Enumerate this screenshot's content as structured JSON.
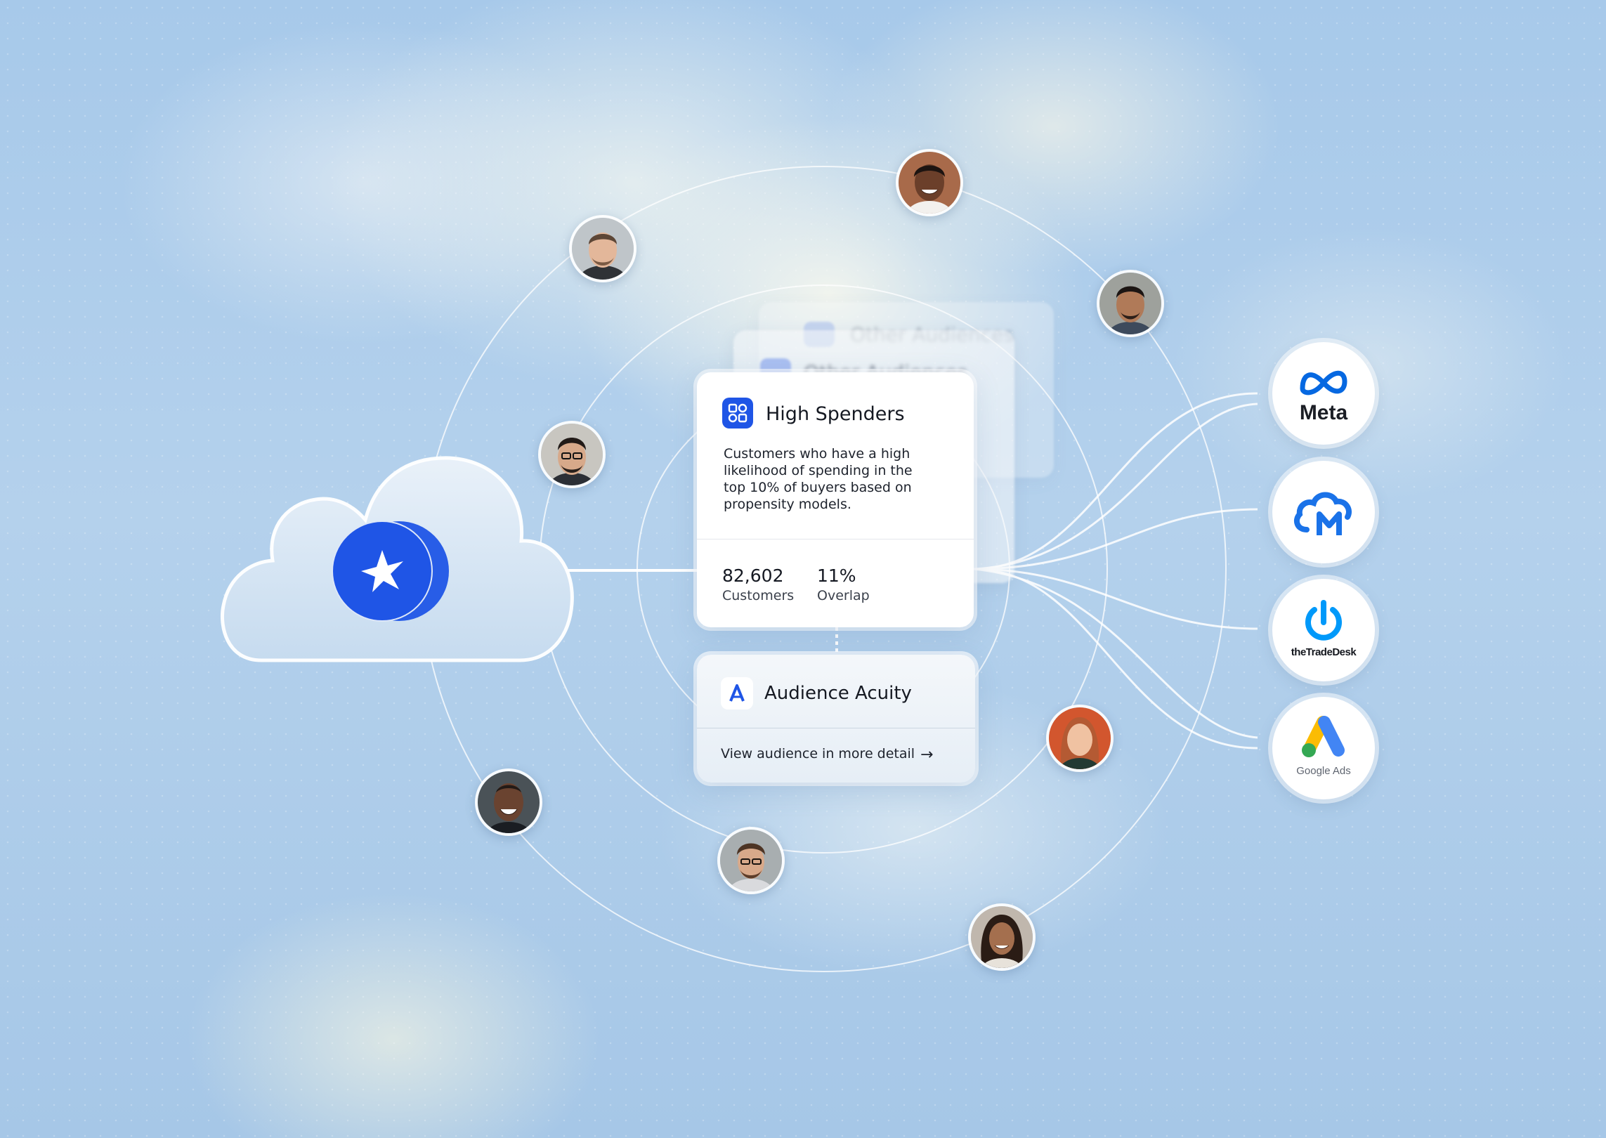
{
  "background": {
    "sky_color": "#a9cbe9",
    "accent": "#1f55e6"
  },
  "source": {
    "icon": "star-burst-icon"
  },
  "ghost_cards": {
    "label": "Other Audiences"
  },
  "high_spenders": {
    "title": "High Spenders",
    "description": "Customers who have a high likelihood  of spending in the top 10% of buyers based on propensity models.",
    "stats": [
      {
        "value": "82,602",
        "label": "Customers"
      },
      {
        "value": "11%",
        "label": "Overlap"
      }
    ]
  },
  "audience_acuity": {
    "title": "Audience Acuity",
    "link": "View audience in more detail",
    "arrow": "→"
  },
  "people": [
    {
      "name": "person-avatar-1",
      "skin": "#e3b79a",
      "hair": "#5d4636",
      "bg": "#bfc5c9"
    },
    {
      "name": "person-avatar-2",
      "skin": "#6b3f2a",
      "hair": "#1d1411",
      "bg": "#a86a4a"
    },
    {
      "name": "person-avatar-3",
      "skin": "#b07a58",
      "hair": "#1c1513",
      "bg": "#9ea19c"
    },
    {
      "name": "person-avatar-4",
      "skin": "#d7a98a",
      "hair": "#211a17",
      "bg": "#c8c6c0"
    },
    {
      "name": "person-avatar-5",
      "skin": "#f0c2a2",
      "hair": "#b45a33",
      "bg": "#d2562e"
    },
    {
      "name": "person-avatar-6",
      "skin": "#6a4330",
      "hair": "#231a16",
      "bg": "#4a5257"
    },
    {
      "name": "person-avatar-7",
      "skin": "#d8a98a",
      "hair": "#4d3424",
      "bg": "#a8aeb0"
    },
    {
      "name": "person-avatar-8",
      "skin": "#a46f4e",
      "hair": "#2a1c15",
      "bg": "#c0b7ad"
    }
  ],
  "partners": [
    {
      "name": "meta-logo",
      "label": "Meta",
      "color": "#0668e1"
    },
    {
      "name": "cm-logo",
      "label": "",
      "color": "#1a72e8"
    },
    {
      "name": "tradedesk-logo",
      "label": "theTradeDesk",
      "color": "#0099fa"
    },
    {
      "name": "google-ads-logo",
      "label": "Google Ads",
      "colors": [
        "#fbbc04",
        "#4285f4",
        "#34a853"
      ]
    }
  ]
}
